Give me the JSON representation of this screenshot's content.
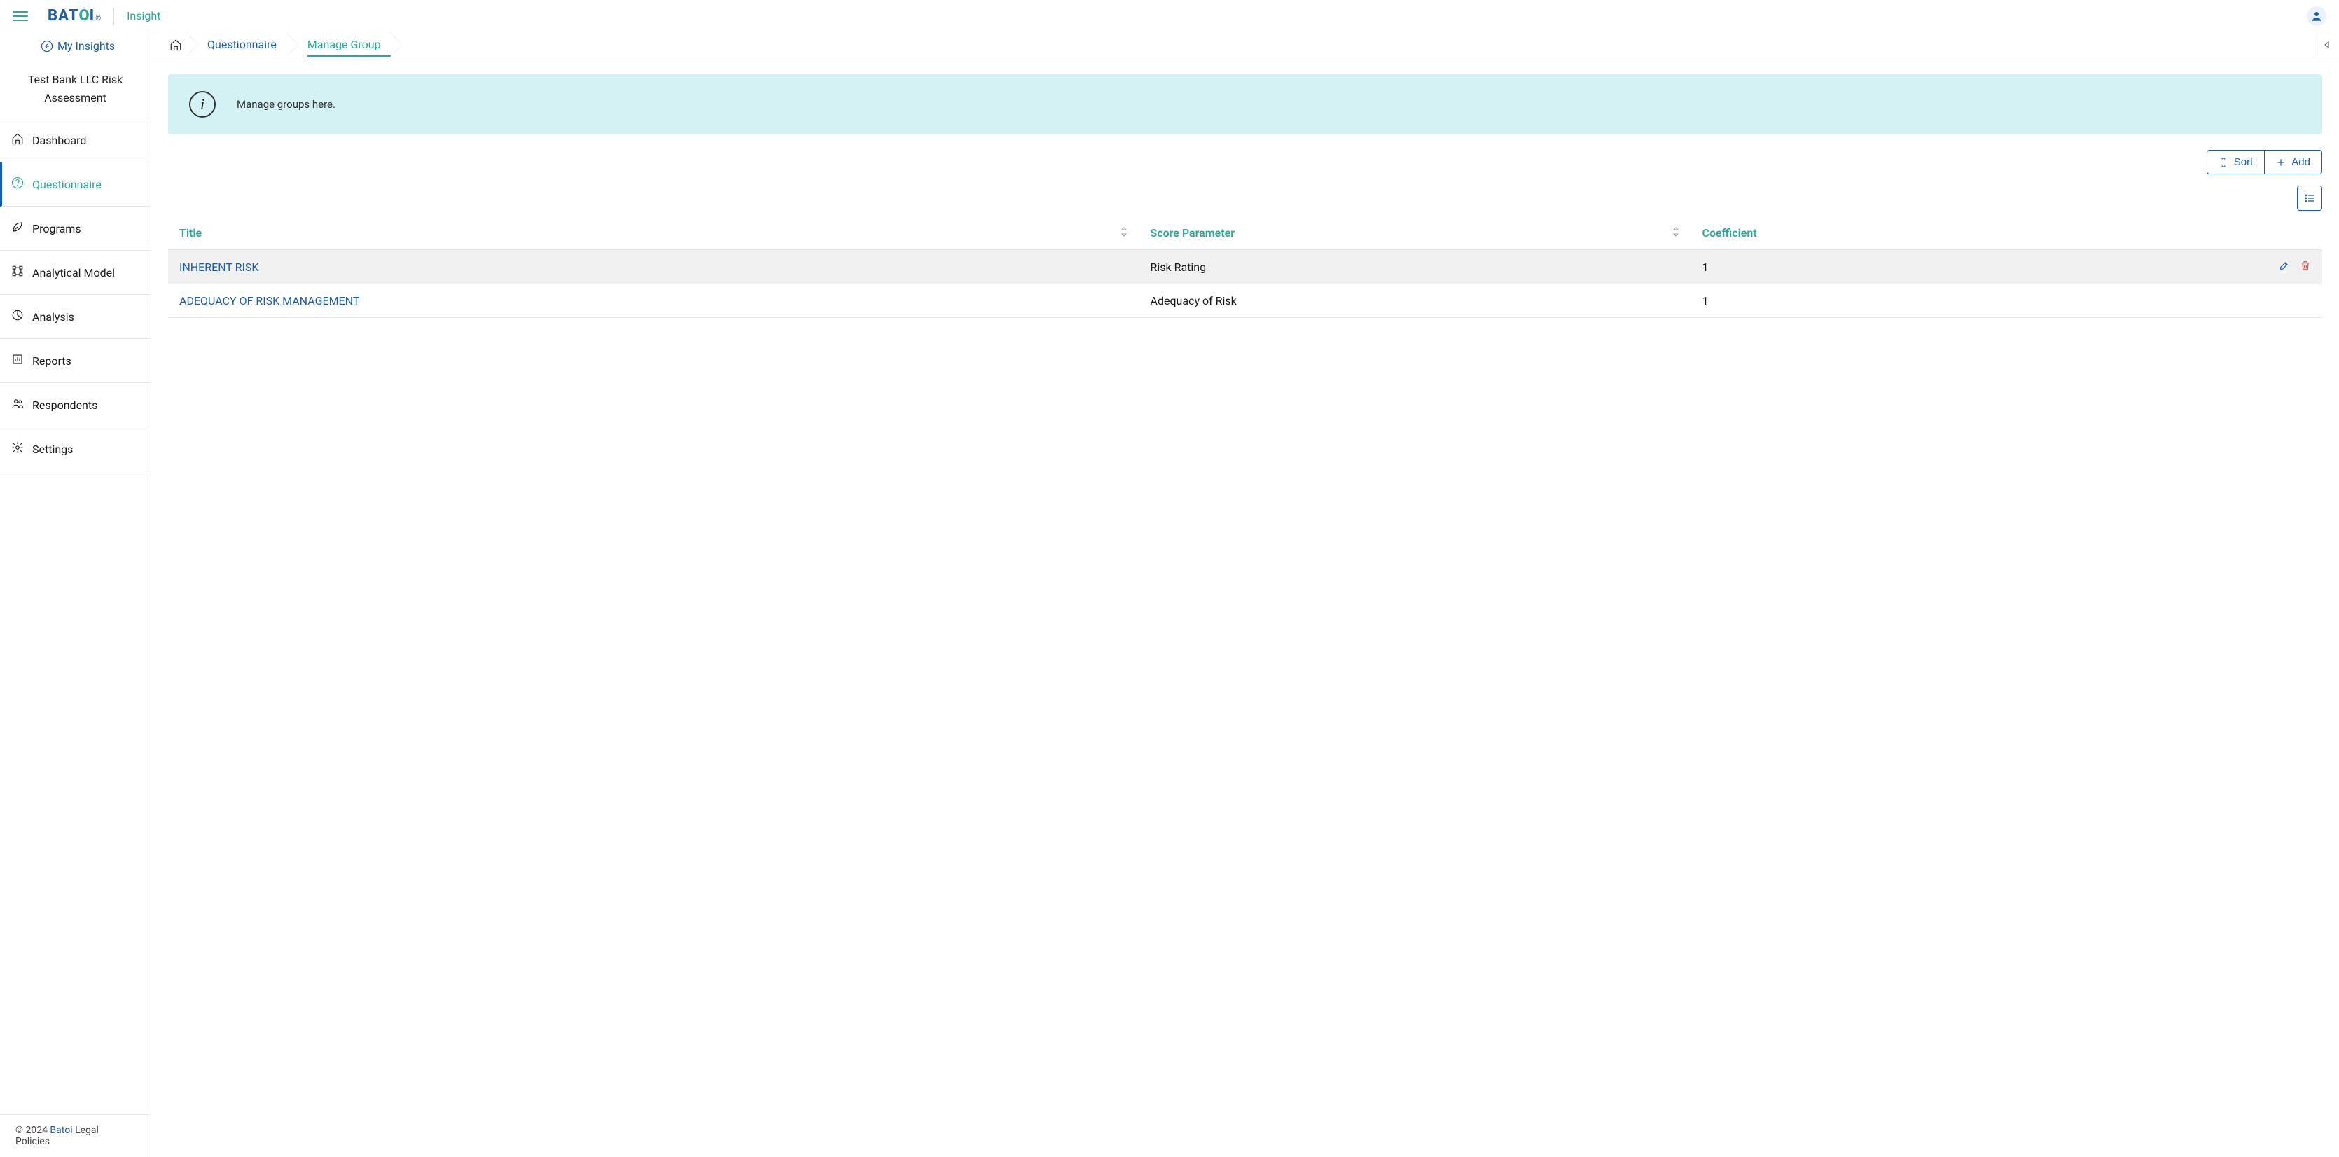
{
  "topbar": {
    "app_name": "Insight",
    "logo_main": "BAT",
    "logo_leaf": "O",
    "logo_tail": "I",
    "logo_reg": "®"
  },
  "sidebar": {
    "my_insights_label": "My Insights",
    "title": "Test Bank LLC Risk Assessment",
    "items": [
      {
        "label": "Dashboard",
        "icon": "home-icon",
        "active": false
      },
      {
        "label": "Questionnaire",
        "icon": "question-icon",
        "active": true
      },
      {
        "label": "Programs",
        "icon": "leaf-icon",
        "active": false
      },
      {
        "label": "Analytical Model",
        "icon": "model-icon",
        "active": false
      },
      {
        "label": "Analysis",
        "icon": "pie-icon",
        "active": false
      },
      {
        "label": "Reports",
        "icon": "bar-icon",
        "active": false
      },
      {
        "label": "Respondents",
        "icon": "users-icon",
        "active": false
      },
      {
        "label": "Settings",
        "icon": "gear-icon",
        "active": false
      }
    ],
    "footer": {
      "copyright": "© 2024 ",
      "brand": "Batoi",
      "policies": " Legal Policies"
    }
  },
  "breadcrumb": {
    "home": "home",
    "items": [
      {
        "label": "Questionnaire",
        "active": false
      },
      {
        "label": "Manage Group",
        "active": true
      }
    ]
  },
  "banner": {
    "message": "Manage groups here."
  },
  "toolbar": {
    "sort_label": "Sort",
    "add_label": "Add"
  },
  "table": {
    "headers": {
      "title": "Title",
      "score_param": "Score Parameter",
      "coefficient": "Coefficient"
    },
    "rows": [
      {
        "title": "INHERENT RISK",
        "score_param": "Risk Rating",
        "coefficient": "1",
        "show_actions": true
      },
      {
        "title": "ADEQUACY OF RISK MANAGEMENT",
        "score_param": "Adequacy of Risk",
        "coefficient": "1",
        "show_actions": false
      }
    ]
  }
}
